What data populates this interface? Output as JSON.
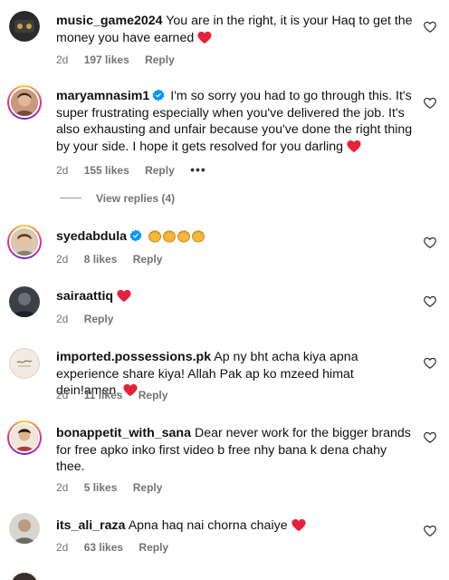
{
  "comments": [
    {
      "username": "music_game2024",
      "verified": false,
      "text": "You are in the right, it is your Haq to get the money you have earned",
      "heart": true,
      "age": "2d",
      "likes": "197 likes",
      "reply": "Reply"
    },
    {
      "username": "maryamnasim1",
      "verified": true,
      "text": "I'm so sorry you had to go through this. It's super frustrating especially when you've delivered the job. It's also exhausting and unfair because you've done the right thing by your side. I hope it gets resolved for you darling",
      "heart": true,
      "age": "2d",
      "likes": "155 likes",
      "reply": "Reply",
      "more": "•••",
      "view_replies": "View replies (4)"
    },
    {
      "username": "syedabdula",
      "verified": true,
      "text": "",
      "emojis": [
        "clapping-hands",
        "clapping-hands",
        "clapping-hands",
        "clapping-hands"
      ],
      "age": "2d",
      "likes": "8 likes",
      "reply": "Reply"
    },
    {
      "username": "sairaattiq",
      "verified": false,
      "text": "",
      "heart": true,
      "age": "2d",
      "reply": "Reply"
    },
    {
      "username": "imported.possessions.pk",
      "verified": false,
      "text": "Ap ny bht acha kiya apna experience share kiya! Allah Pak ap ko mzeed himat dein!amen.",
      "heart": true,
      "age": "2d",
      "likes": "11 likes",
      "reply": "Reply"
    },
    {
      "username": "bonappetit_with_sana",
      "verified": false,
      "text": "Dear never work for the bigger brands for free apko inko first video b free nhy bana k dena chahy thee.",
      "age": "2d",
      "likes": "5 likes",
      "reply": "Reply"
    },
    {
      "username": "its_ali_raza",
      "verified": false,
      "text": "Apna haq nai chorna chaiye",
      "heart": true,
      "age": "2d",
      "likes": "63 likes",
      "reply": "Reply"
    }
  ],
  "colors": {
    "heart_red": "#e8213b",
    "verified_blue": "#0095f6",
    "meta_gray": "#737373"
  },
  "icons": {
    "like": "heart-outline-icon",
    "verified": "verified-badge-icon",
    "inline_heart": "red-heart-emoji"
  }
}
